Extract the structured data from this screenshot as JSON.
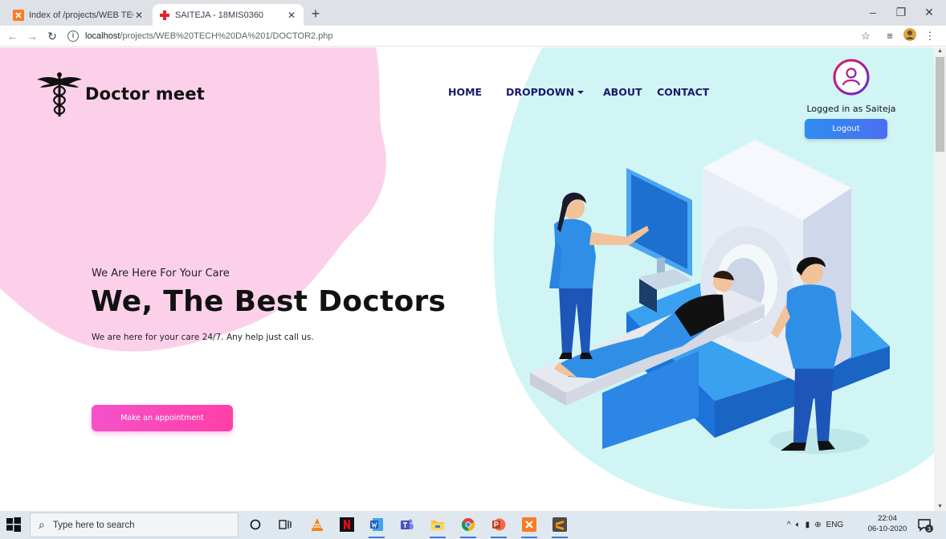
{
  "browser": {
    "tabs": [
      {
        "title": "Index of /projects/WEB TECH DA",
        "active": false
      },
      {
        "title": "SAITEJA - 18MIS0360",
        "active": true
      }
    ],
    "url_host": "localhost",
    "url_path": "/projects/WEB%20TECH%20DA%201/DOCTOR2.php"
  },
  "site": {
    "brand": "Doctor meet",
    "nav": [
      "HOME",
      "DROPDOWN",
      "ABOUT",
      "CONTACT"
    ],
    "user_status": "Logged in as Saiteja",
    "logout_label": "Logout",
    "hero_sub": "We Are Here For Your Care",
    "hero_title": "We, The Best Doctors",
    "hero_desc": "We are here for your care 24/7. Any help just call us.",
    "cta_label": "Make an appointment",
    "colors": {
      "pink_blob": "#fdd0ea",
      "cyan_bg": "#d1f5f5",
      "nav_text": "#1a1a6b",
      "cta": "#f651c9",
      "logout": "#2f8df0"
    }
  },
  "taskbar": {
    "search_placeholder": "Type here to search",
    "language": "ENG",
    "time": "22:04",
    "date": "06-10-2020",
    "notification_count": "3"
  }
}
